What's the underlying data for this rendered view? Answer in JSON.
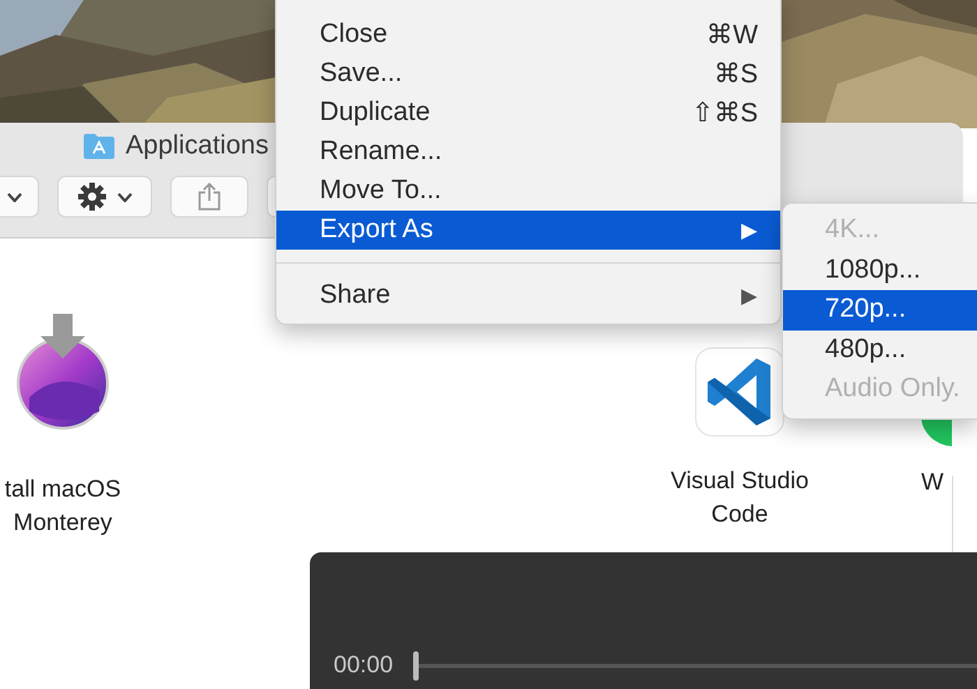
{
  "finder": {
    "title": "Applications",
    "apps": [
      {
        "kind": "installer",
        "lines": [
          "tall macOS",
          "Monterey"
        ]
      },
      {
        "kind": "vscode",
        "lines": [
          "Visual Studio",
          "Code"
        ]
      },
      {
        "kind": "green",
        "lines": [
          "W"
        ]
      }
    ]
  },
  "menu": {
    "items": [
      {
        "kind": "item",
        "label": "Close",
        "shortcut": "⌘W",
        "selected": false
      },
      {
        "kind": "item",
        "label": "Save...",
        "shortcut": "⌘S",
        "selected": false
      },
      {
        "kind": "item",
        "label": "Duplicate",
        "shortcut": "⇧⌘S",
        "selected": false
      },
      {
        "kind": "item",
        "label": "Rename...",
        "selected": false
      },
      {
        "kind": "item",
        "label": "Move To...",
        "selected": false
      },
      {
        "kind": "submenu",
        "label": "Export As",
        "arrow": "▶",
        "selected": true
      },
      {
        "kind": "separator"
      },
      {
        "kind": "submenu",
        "label": "Share",
        "arrow": "▶",
        "selected": false
      }
    ]
  },
  "submenu": {
    "items": [
      {
        "label": "4K...",
        "disabled": true,
        "selected": false
      },
      {
        "label": "1080p...",
        "disabled": false,
        "selected": false
      },
      {
        "label": "720p...",
        "disabled": false,
        "selected": true
      },
      {
        "label": "480p...",
        "disabled": false,
        "selected": false
      },
      {
        "label": "Audio Only.",
        "disabled": true,
        "selected": false
      }
    ]
  },
  "player": {
    "time": "00:00",
    "level": 0
  }
}
